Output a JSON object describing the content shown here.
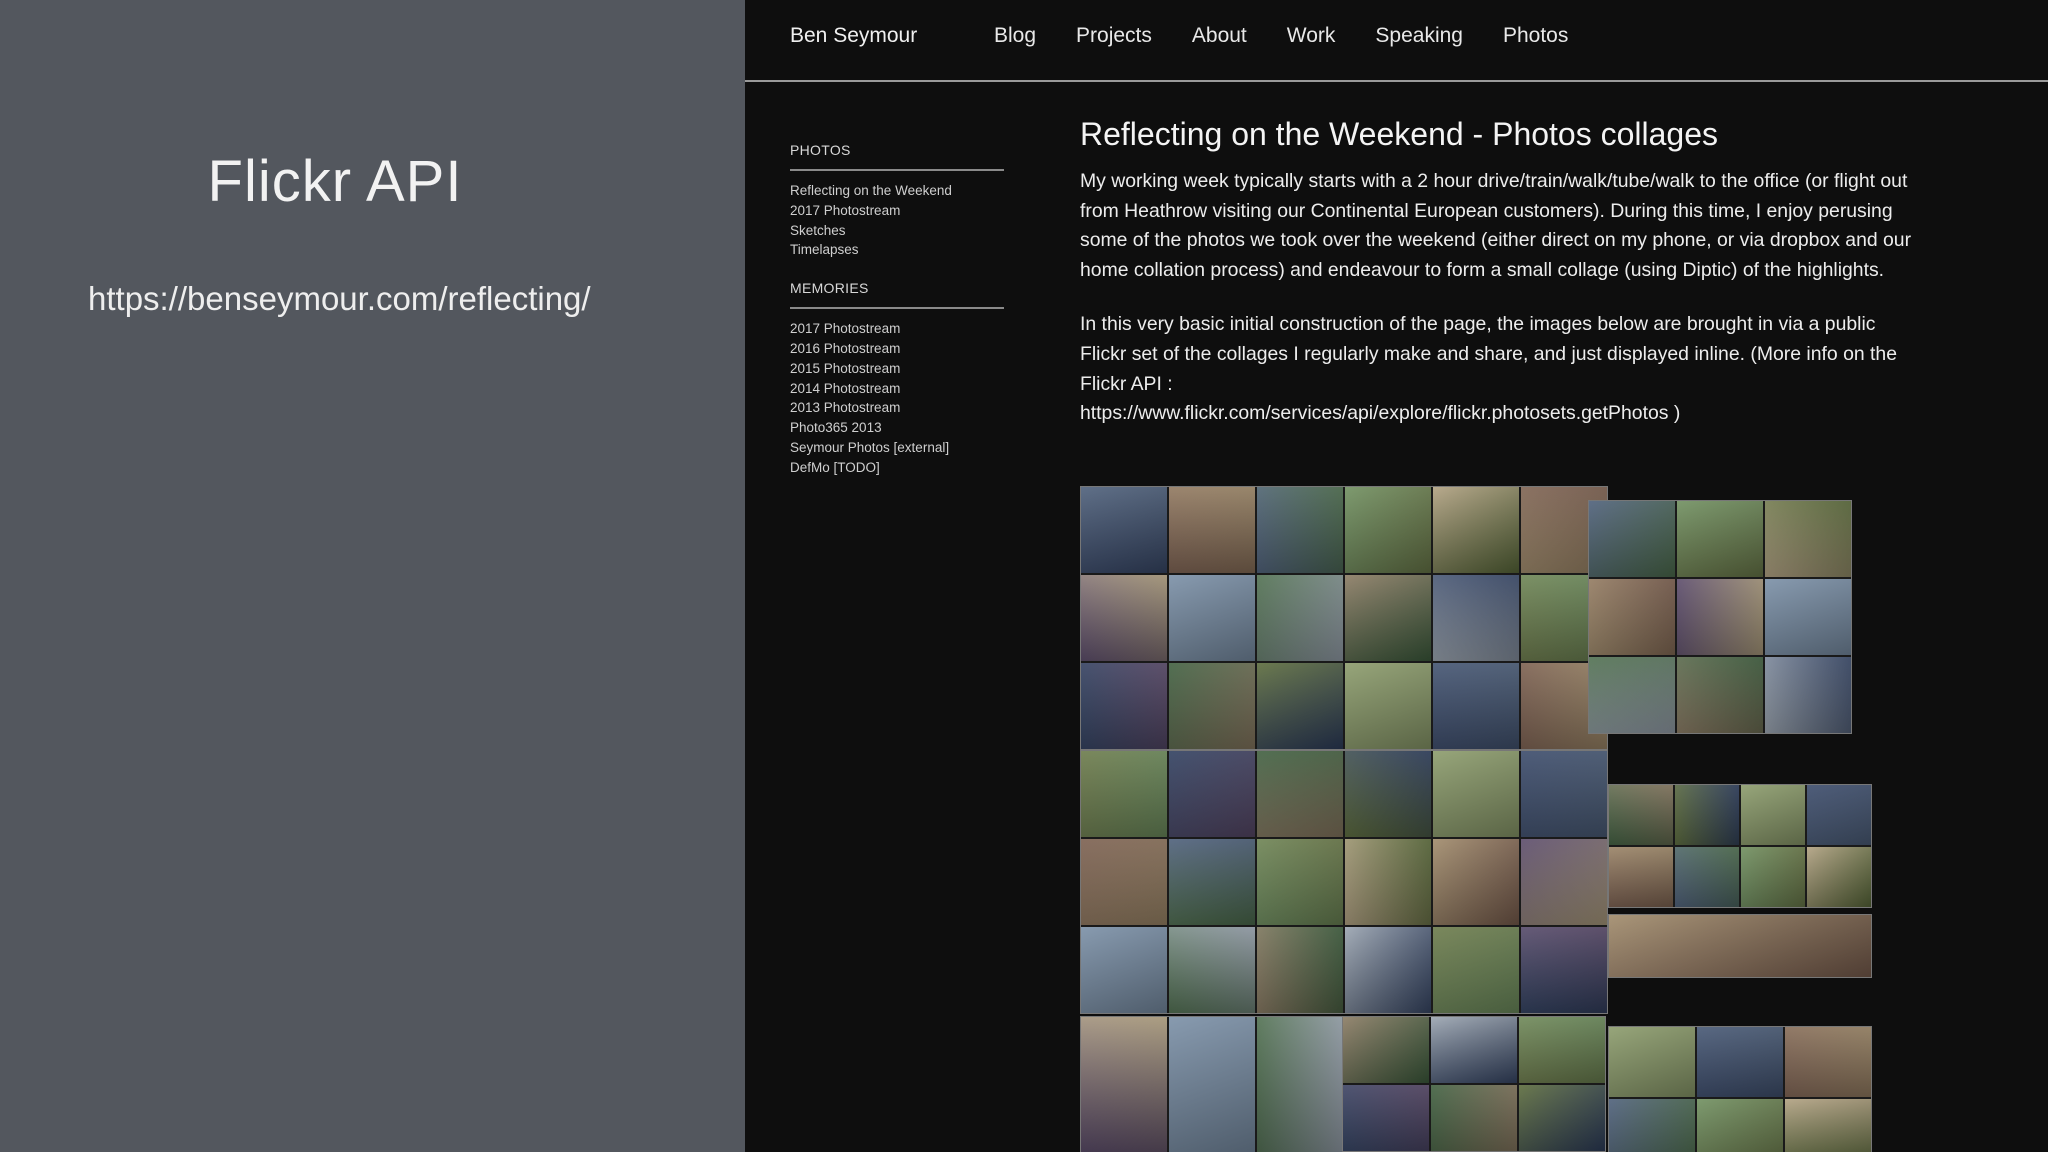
{
  "slide": {
    "title": "Flickr API",
    "url": "https://benseymour.com/reflecting/"
  },
  "site": {
    "brand": "Ben Seymour",
    "nav": [
      "Blog",
      "Projects",
      "About",
      "Work",
      "Speaking",
      "Photos"
    ],
    "sidebar": {
      "photos_heading": "PHOTOS",
      "photos_items": [
        "Reflecting on the Weekend",
        "2017 Photostream",
        "Sketches",
        "Timelapses"
      ],
      "memories_heading": "MEMORIES",
      "memories_items": [
        "2017 Photostream",
        "2016 Photostream",
        "2015 Photostream",
        "2014 Photostream",
        "2013 Photostream",
        "Photo365 2013",
        "Seymour Photos [external]",
        "DefMo [TODO]"
      ]
    },
    "post": {
      "title": "Reflecting on the Weekend - Photos collages",
      "para1": "My working week typically starts with a 2 hour drive/train/walk/tube/walk to the office (or flight out from Heathrow visiting our Continental European customers). During this time, I enjoy perusing some of the photos we took over the weekend (either direct on my phone, or via dropbox and our home collation process) and endeavour to form a small collage (using Diptic) of the highlights.",
      "para2": "In this very basic initial construction of the page, the images below are brought in via a public Flickr set of the collages I regularly make and share, and just displayed inline. (More info on the Flickr API :",
      "api_link": "https://www.flickr.com/services/api/explore/flickr.photosets.getPhotos )"
    }
  },
  "colors": {
    "slide_bg": "#53575e",
    "site_bg": "#0e0e0e",
    "text": "#ededed"
  }
}
